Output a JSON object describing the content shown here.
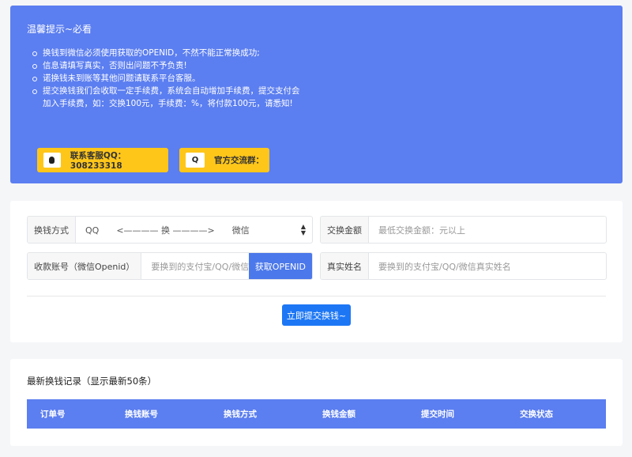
{
  "notice": {
    "title": "温馨提示~必看",
    "items": [
      "换钱到微信必须使用获取的OPENID，不然不能正常换成功;",
      "信息请填写真实，否则出问题不予负责!",
      "诺换钱未到账等其他问题请联系平台客服。",
      "提交换钱我们会收取一定手续费，系统会自动增加手续费，提交支付会加入手续费，如：交换100元，手续费：%，将付款100元，请悉知!"
    ],
    "qq_button": "联系客服QQ：308233318",
    "group_button": "官方交流群：",
    "group_icon": "Q"
  },
  "form": {
    "method_label": "换钱方式",
    "method_value": "QQ　　<———— 换 ————>　　微信",
    "amount_label": "交换金额",
    "amount_placeholder": "最低交换金额：元以上",
    "account_label": "收款账号（微信Openid）",
    "account_placeholder": "要换到的支付宝/QQ/微信",
    "openid_button": "获取OPENID",
    "name_label": "真实姓名",
    "name_placeholder": "要换到的支付宝/QQ/微信真实姓名",
    "submit": "立即提交换钱~"
  },
  "records": {
    "title": "最新换钱记录（显示最新50条）",
    "columns": [
      "订单号",
      "换钱账号",
      "换钱方式",
      "换钱金额",
      "提交时间",
      "交换状态"
    ]
  },
  "colors": {
    "accent": "#5b7ef0",
    "warning": "#ffc61a",
    "primary": "#1d77f5"
  }
}
